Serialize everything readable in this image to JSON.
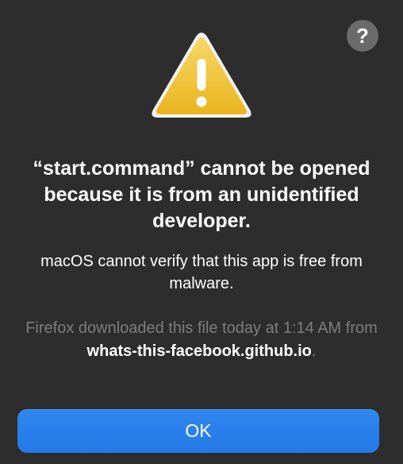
{
  "dialog": {
    "title": "“start.command” cannot be opened because it is from an unidentified developer.",
    "message": "macOS cannot verify that this app is free from malware.",
    "info_prefix": "Firefox downloaded this file today at 1:14 AM from ",
    "info_source": "whats-this-facebook.github.io",
    "info_suffix": ".",
    "help_label": "?",
    "ok_label": "OK",
    "icon": "warning-triangle-icon"
  },
  "colors": {
    "background": "#2d2d2d",
    "ok_button": "#2a80ea",
    "help_button": "#6b6b6b",
    "warning_yellow": "#f0c530",
    "secondary_text": "#7d7d7d"
  }
}
